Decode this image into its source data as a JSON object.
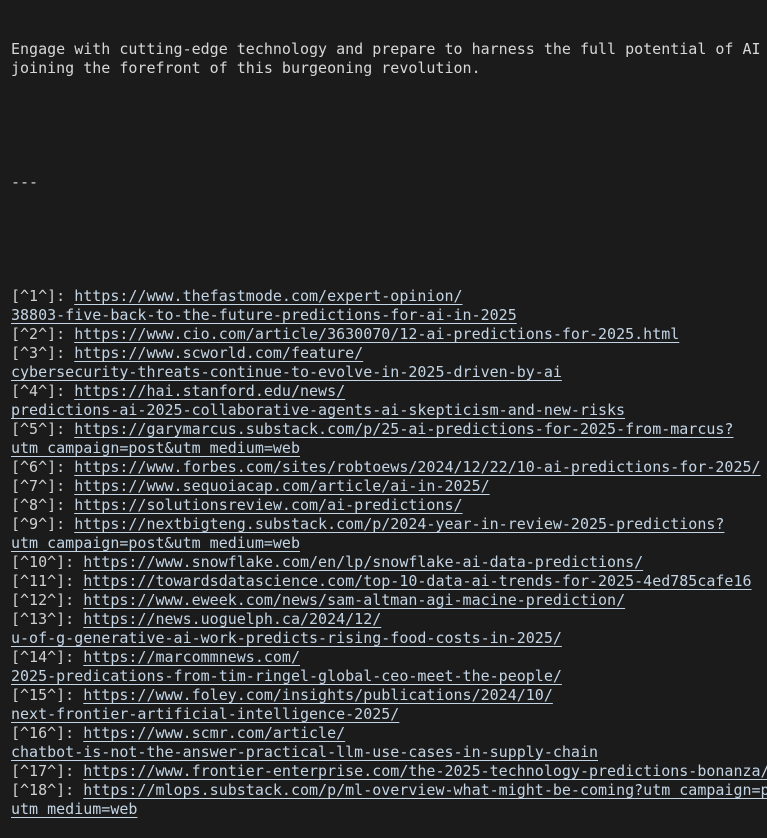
{
  "terminal": {
    "background_color": "#1b1b1b",
    "text_color": "#d7d7d7",
    "link_color": "#c3d4e4",
    "paragraph": [
      "Engage with cutting-edge technology and prepare to harness the full potential of AI by",
      "joining the forefront of this burgeoning revolution."
    ],
    "separator": "---",
    "references": [
      {
        "marker": "[^1^]:",
        "url_lines": [
          "https://www.thefastmode.com/expert-opinion/",
          "38803-five-back-to-the-future-predictions-for-ai-in-2025"
        ]
      },
      {
        "marker": "[^2^]:",
        "url_lines": [
          "https://www.cio.com/article/3630070/12-ai-predictions-for-2025.html"
        ]
      },
      {
        "marker": "[^3^]:",
        "url_lines": [
          "https://www.scworld.com/feature/",
          "cybersecurity-threats-continue-to-evolve-in-2025-driven-by-ai"
        ]
      },
      {
        "marker": "[^4^]:",
        "url_lines": [
          "https://hai.stanford.edu/news/",
          "predictions-ai-2025-collaborative-agents-ai-skepticism-and-new-risks"
        ]
      },
      {
        "marker": "[^5^]:",
        "url_lines": [
          "https://garymarcus.substack.com/p/25-ai-predictions-for-2025-from-marcus?",
          "utm_campaign=post&utm_medium=web"
        ]
      },
      {
        "marker": "[^6^]:",
        "url_lines": [
          "https://www.forbes.com/sites/robtoews/2024/12/22/10-ai-predictions-for-2025/"
        ]
      },
      {
        "marker": "[^7^]:",
        "url_lines": [
          "https://www.sequoiacap.com/article/ai-in-2025/"
        ]
      },
      {
        "marker": "[^8^]:",
        "url_lines": [
          "https://solutionsreview.com/ai-predictions/"
        ]
      },
      {
        "marker": "[^9^]:",
        "url_lines": [
          "https://nextbigteng.substack.com/p/2024-year-in-review-2025-predictions?",
          "utm_campaign=post&utm_medium=web"
        ]
      },
      {
        "marker": "[^10^]:",
        "url_lines": [
          "https://www.snowflake.com/en/lp/snowflake-ai-data-predictions/"
        ]
      },
      {
        "marker": "[^11^]:",
        "url_lines": [
          "https://towardsdatascience.com/top-10-data-ai-trends-for-2025-4ed785cafe16"
        ]
      },
      {
        "marker": "[^12^]:",
        "url_lines": [
          "https://www.eweek.com/news/sam-altman-agi-macine-prediction/"
        ]
      },
      {
        "marker": "[^13^]:",
        "url_lines": [
          "https://news.uoguelph.ca/2024/12/",
          "u-of-g-generative-ai-work-predicts-rising-food-costs-in-2025/"
        ]
      },
      {
        "marker": "[^14^]:",
        "url_lines": [
          "https://marcommnews.com/",
          "2025-predications-from-tim-ringel-global-ceo-meet-the-people/"
        ]
      },
      {
        "marker": "[^15^]:",
        "url_lines": [
          "https://www.foley.com/insights/publications/2024/10/",
          "next-frontier-artificial-intelligence-2025/"
        ]
      },
      {
        "marker": "[^16^]:",
        "url_lines": [
          "https://www.scmr.com/article/",
          "chatbot-is-not-the-answer-practical-llm-use-cases-in-supply-chain"
        ]
      },
      {
        "marker": "[^17^]:",
        "url_lines": [
          "https://www.frontier-enterprise.com/the-2025-technology-predictions-bonanza/"
        ]
      },
      {
        "marker": "[^18^]:",
        "url_lines": [
          "https://mlops.substack.com/p/ml-overview-what-might-be-coming?utm_campaign=post&",
          "utm_medium=web"
        ]
      }
    ]
  }
}
